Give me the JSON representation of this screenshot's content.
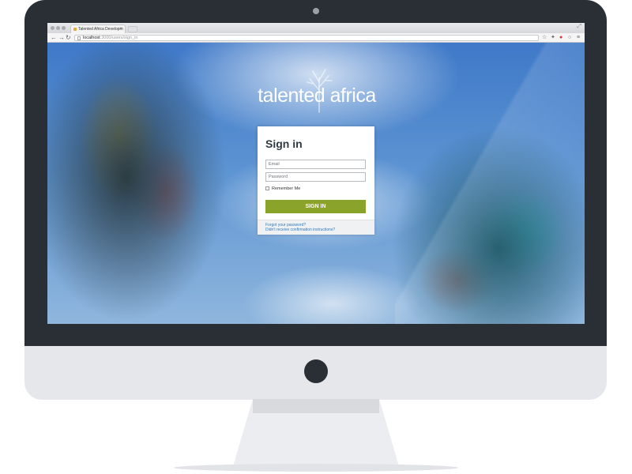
{
  "browser": {
    "tab_title": "Talented Africa Developm",
    "tab_close": "×",
    "url_host": "localhost",
    "url_path": ":3000/users/sign_in"
  },
  "page": {
    "brand": "talented africa",
    "signin": {
      "title": "Sign in",
      "email_placeholder": "Email",
      "password_placeholder": "Password",
      "remember_label": "Remember Me",
      "button_label": "SIGN IN",
      "forgot_link": "Forgot your password?",
      "confirm_link": "Didn't receive confirmation instructions?"
    }
  },
  "colors": {
    "bezel": "#2a2f36",
    "button": "#8aa32a",
    "link": "#2f7bbd",
    "title": "#2f3a44"
  },
  "icons": [
    "camera-icon",
    "power-button",
    "back-icon",
    "forward-icon",
    "reload-icon",
    "page-icon",
    "star-icon",
    "extension-icon",
    "menu-icon"
  ]
}
